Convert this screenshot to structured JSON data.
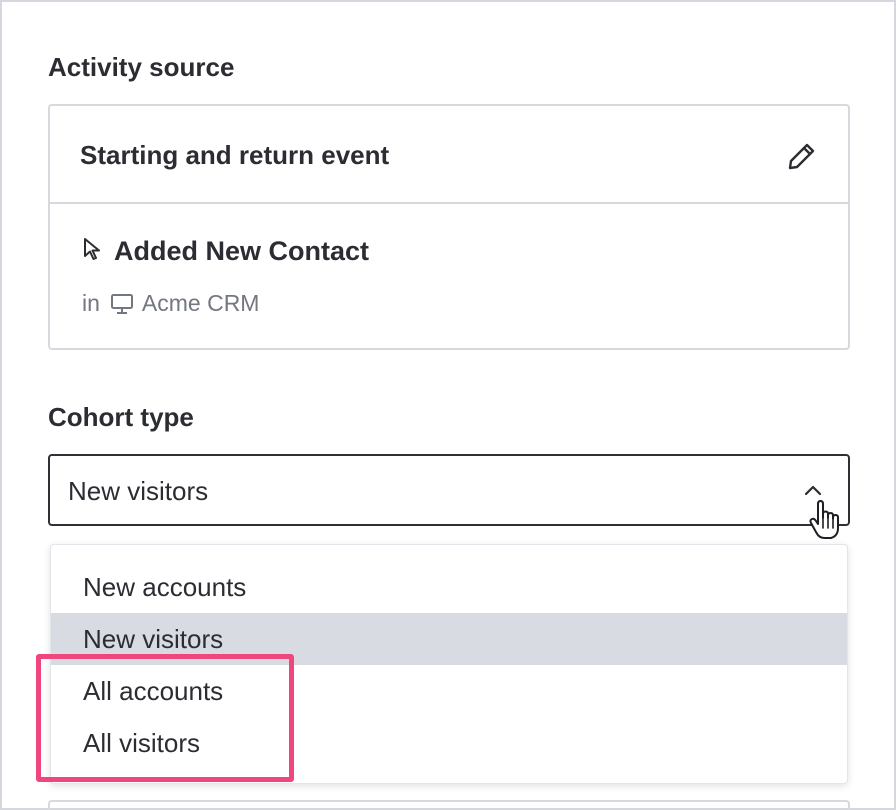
{
  "activity_source": {
    "label": "Activity source",
    "card": {
      "title": "Starting and return event",
      "edit_icon": "pencil-icon",
      "event_name": "Added New Contact",
      "event_icon": "cursor-icon",
      "source_prefix": "in",
      "source_icon": "monitor-icon",
      "source_app": "Acme CRM"
    }
  },
  "cohort_type": {
    "label": "Cohort type",
    "selected_value": "New visitors",
    "open": true,
    "options": [
      {
        "label": "New accounts",
        "selected": false
      },
      {
        "label": "New visitors",
        "selected": true
      },
      {
        "label": "All accounts",
        "selected": false
      },
      {
        "label": "All visitors",
        "selected": false
      }
    ]
  },
  "colors": {
    "highlight": "#f0467e",
    "selected_option_bg": "#d8dbe1",
    "text": "#2b2d33",
    "muted_text": "#737780",
    "border": "#d6dadf"
  }
}
